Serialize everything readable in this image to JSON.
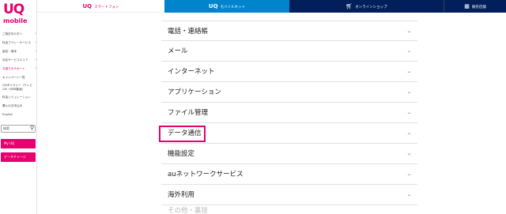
{
  "logo": {
    "uq": "UQ",
    "mobile": "mobile"
  },
  "sidebar": {
    "items": [
      {
        "label": "ご検討中の方へ",
        "chev": "›"
      },
      {
        "label": "料金プラン・サービス",
        "chev": "›"
      },
      {
        "label": "製品・端末",
        "chev": "›"
      },
      {
        "label": "対応サービスエリア",
        "chev": "›"
      },
      {
        "label": "お困りのサポート",
        "chev": "›"
      },
      {
        "label": "キャンペーン一覧",
        "chev": ""
      },
      {
        "label": "CMギャラリー（テレビCM・WEB動画）",
        "chev": ""
      },
      {
        "label": "料金シミュレーション",
        "chev": ""
      },
      {
        "label": "購入のお申込み",
        "chev": ""
      },
      {
        "label": "English",
        "chev": ""
      }
    ],
    "search_placeholder": "検索",
    "myuq": "My UQ",
    "charge": "データチャージ"
  },
  "topnav": {
    "smart_logo": "UQ",
    "smart_label": "スマートフォン",
    "wimax_logo": "UQ",
    "wimax_label": "モバイルネット",
    "shop_label": "オンラインショップ",
    "store_label": "販売店舗"
  },
  "accordion": {
    "items": [
      "電話・連絡帳",
      "メール",
      "インターネット",
      "アプリケーション",
      "ファイル管理",
      "データ通信",
      "機能設定",
      "auネットワークサービス",
      "海外利用"
    ],
    "chev": "⌄",
    "cutoff_text": "その他・裏技"
  },
  "colors": {
    "brand_pink": "#e8006e",
    "wimax_blue": "#0085cc",
    "navy": "#001f5b"
  },
  "icons": {
    "search": "search-icon",
    "cart": "cart-icon",
    "store": "store-icon"
  }
}
